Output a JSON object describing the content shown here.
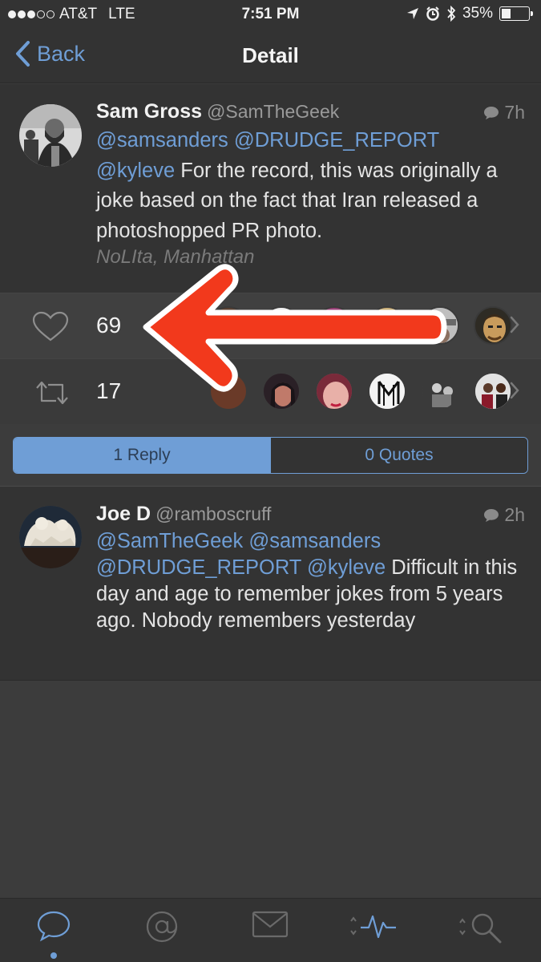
{
  "status_bar": {
    "carrier": "AT&T",
    "network": "LTE",
    "time": "7:51 PM",
    "battery": "35%",
    "battery_level": 0.35
  },
  "nav": {
    "back_label": "Back",
    "title": "Detail"
  },
  "tweet": {
    "author_name": "Sam Gross",
    "author_handle": "@SamTheGeek",
    "time_ago": "7h",
    "mention_1": "@samsanders",
    "mention_2": "@DRUDGE_REPORT",
    "mention_3": "@kyleve",
    "text": " For the record, this was originally a joke based on the fact that Iran released a photoshopped PR photo.",
    "location": "NoLIta, Manhattan"
  },
  "likes": {
    "count": "69"
  },
  "retweets": {
    "count": "17"
  },
  "segment": {
    "replies_label": "1 Reply",
    "quotes_label": "0 Quotes"
  },
  "reply": {
    "author_name": "Joe D",
    "author_handle": "@ramboscruff",
    "time_ago": "2h",
    "mention_1": "@SamTheGeek",
    "mention_2": "@samsanders",
    "mention_3": "@DRUDGE_REPORT",
    "mention_4": "@kyleve",
    "text": " Difficult in this day and age to remember jokes from 5 years ago.  Nobody remembers yesterday"
  },
  "tab_bar": {
    "tabs": [
      "timeline-tab",
      "mentions-tab",
      "messages-tab",
      "activity-tab",
      "search-tab"
    ]
  },
  "colors": {
    "accent": "#6f9ed6",
    "arrow": "#f2391c",
    "background": "#333333"
  }
}
